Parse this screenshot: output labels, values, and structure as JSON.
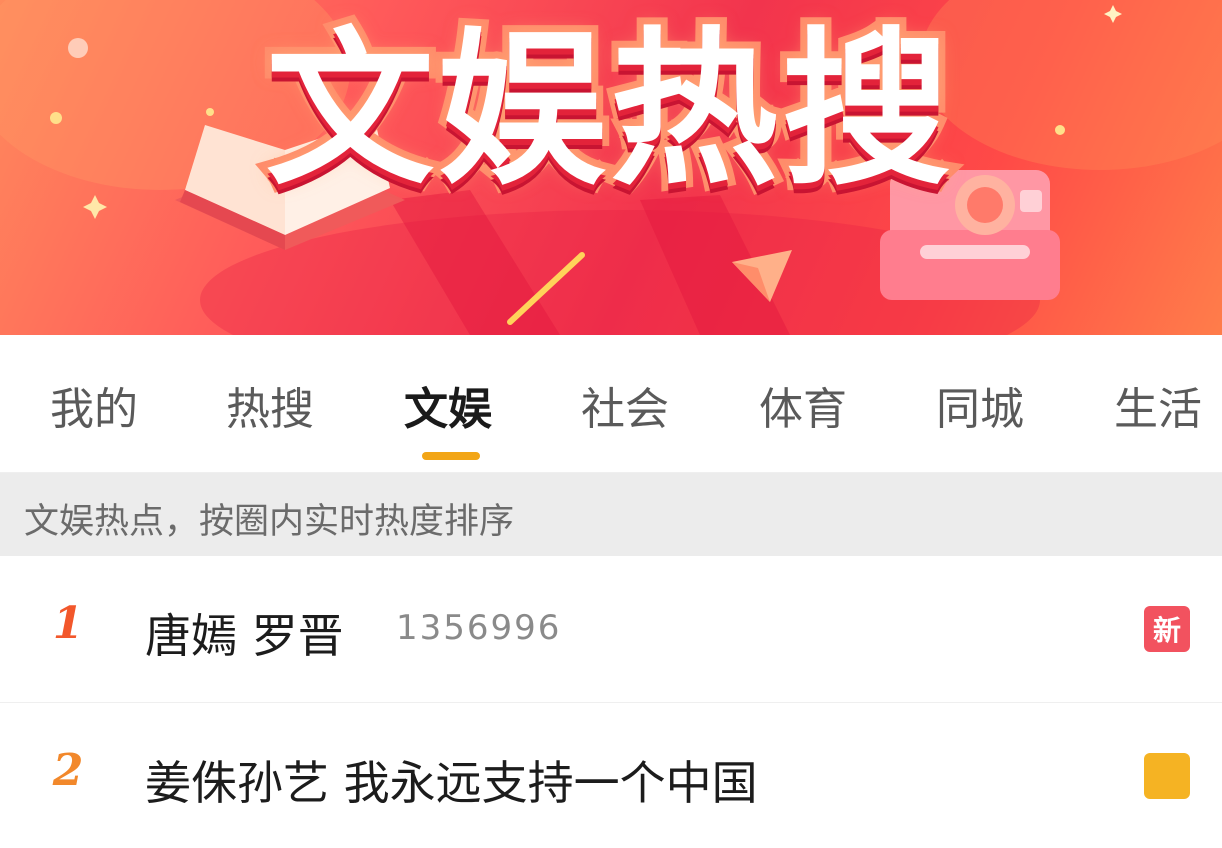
{
  "banner": {
    "title": "文娱热搜"
  },
  "tabs": [
    {
      "label": "我的"
    },
    {
      "label": "热搜"
    },
    {
      "label": "文娱",
      "active": true
    },
    {
      "label": "社会"
    },
    {
      "label": "体育"
    },
    {
      "label": "同城"
    },
    {
      "label": "生活"
    }
  ],
  "info": {
    "text": "文娱热点，按圈内实时热度排序"
  },
  "list": [
    {
      "rank": "1",
      "topic": "唐嫣 罗晋",
      "heat": "1356996",
      "badge": "新"
    },
    {
      "rank": "2",
      "topic": "姜侏孙艺 我永远支持一个中国",
      "heat": "",
      "badge": ""
    }
  ],
  "colors": {
    "accent": "#f2a516",
    "banner": "#f2344d",
    "badge_new": "#f2525f",
    "rank": "#f2572b"
  }
}
